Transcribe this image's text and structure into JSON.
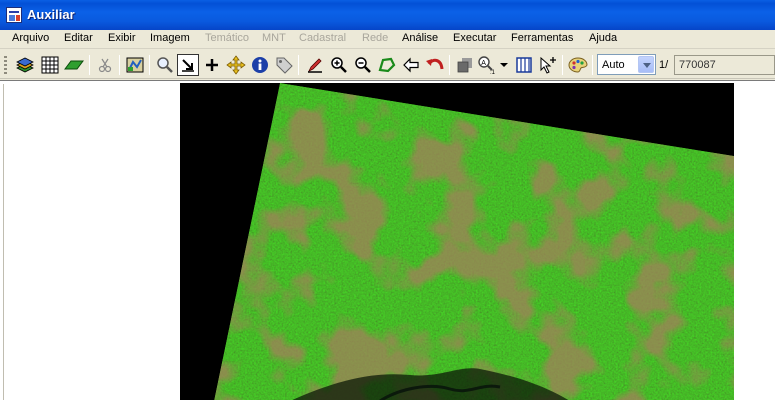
{
  "window": {
    "title": "Auxiliar"
  },
  "menu": [
    {
      "label": "Arquivo",
      "enabled": true
    },
    {
      "label": "Editar",
      "enabled": true
    },
    {
      "label": "Exibir",
      "enabled": true
    },
    {
      "label": "Imagem",
      "enabled": true
    },
    {
      "label": "Temático",
      "enabled": false
    },
    {
      "label": "MNT",
      "enabled": false
    },
    {
      "label": "Cadastral",
      "enabled": false
    },
    {
      "label": "Rede",
      "enabled": false
    },
    {
      "label": "Análise",
      "enabled": true
    },
    {
      "label": "Executar",
      "enabled": true
    },
    {
      "label": "Ferramentas",
      "enabled": true
    },
    {
      "label": "Ajuda",
      "enabled": true
    }
  ],
  "toolbar": {
    "icons": [
      "layers-icon",
      "grid-icon",
      "plane-icon",
      "scissors-icon",
      "map-edit-icon",
      "magnifier-icon",
      "select-arrow-icon",
      "crosshair-icon",
      "pan-icon",
      "info-icon",
      "tag-icon",
      "pencil-icon",
      "zoom-in-icon",
      "zoom-out-icon",
      "polygon-icon",
      "back-arrow-icon",
      "undo-icon",
      "overlay-icon",
      "scale-tool-icon",
      "display-icon",
      "cursor-plus-icon",
      "palette-icon"
    ],
    "scale_select": {
      "value": "Auto"
    },
    "scale_prefix": "1/",
    "scale_value": "770087"
  },
  "colors": {
    "title_bar": "#0a5fe4",
    "menu_bg": "#ece9d8",
    "image_green": "#3c7a1a",
    "image_brown": "#5c3a1c"
  }
}
